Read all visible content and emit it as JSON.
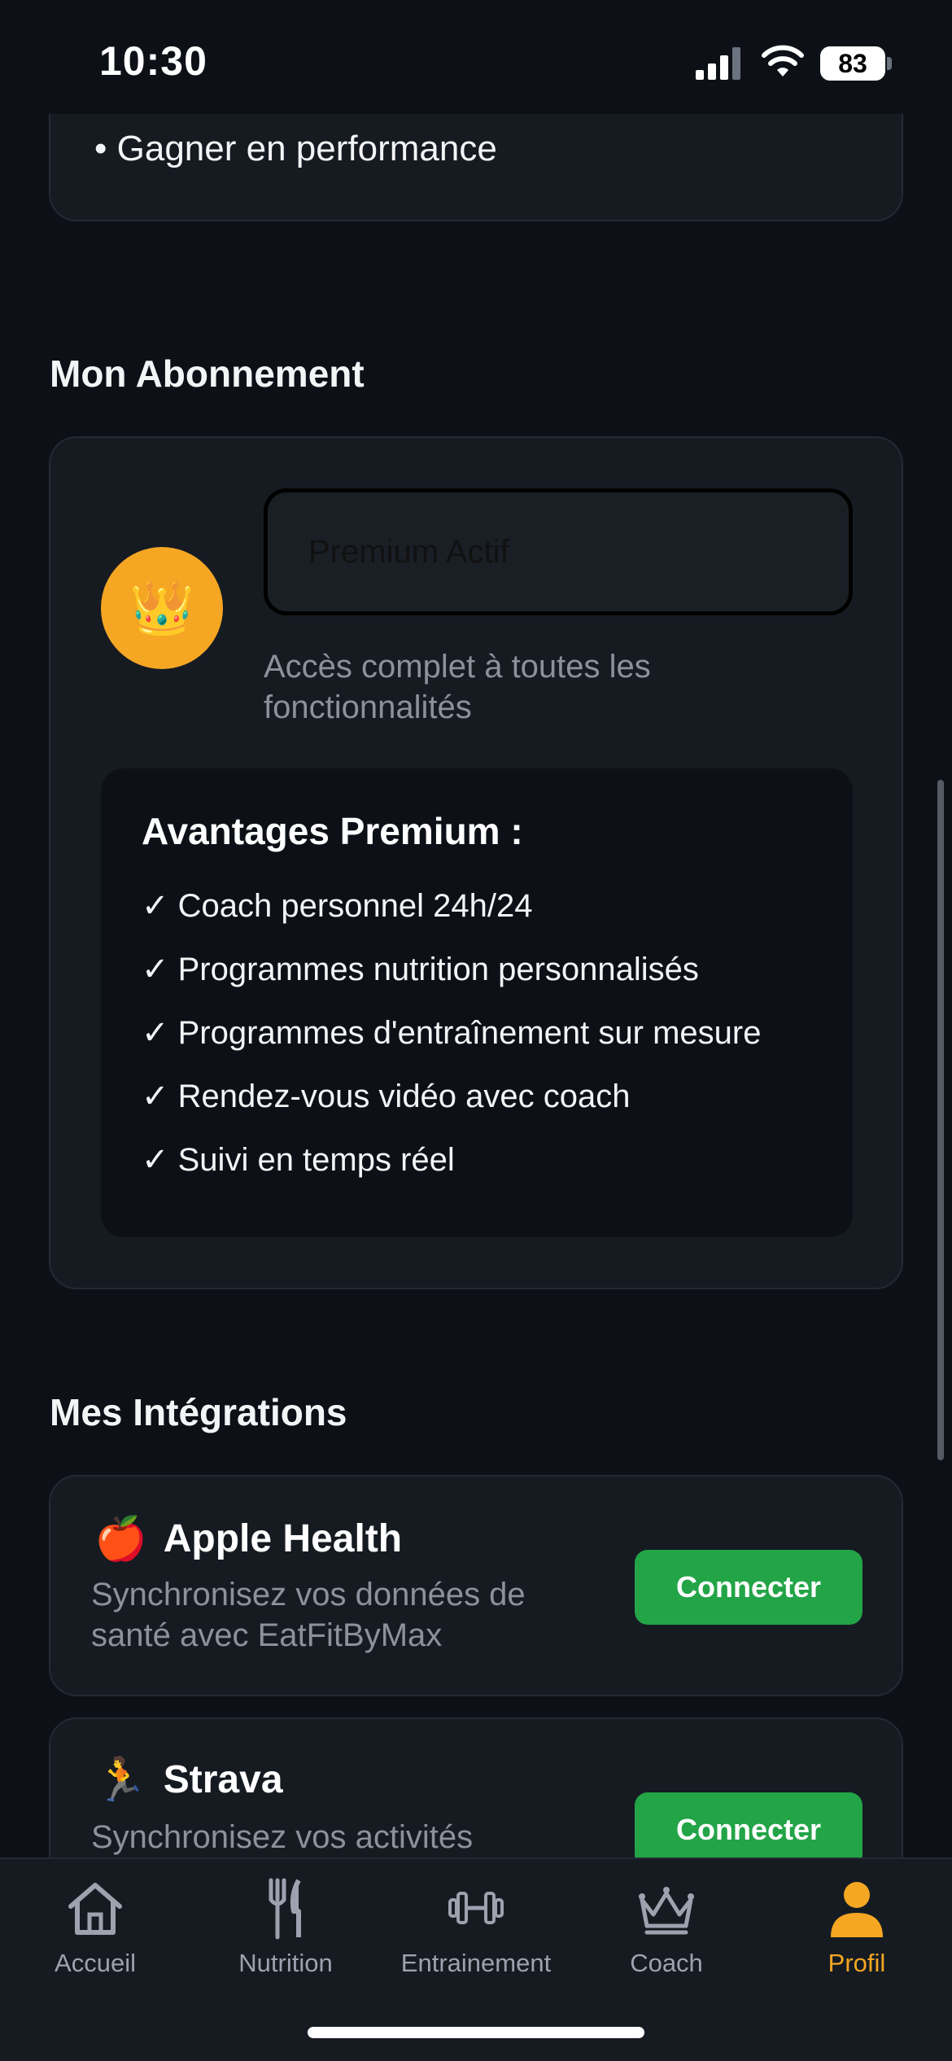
{
  "status_bar": {
    "time": "10:30",
    "battery": "83"
  },
  "goals": {
    "last_item": "• Gagner en performance"
  },
  "subscription": {
    "section_title": "Mon Abonnement",
    "plan_value": "Premium Actif",
    "crown_icon": "👑",
    "description": "Accès complet à toutes les fonctionnalités",
    "benefits_title": "Avantages Premium :",
    "benefits": [
      "✓ Coach personnel 24h/24",
      "✓ Programmes nutrition personnalisés",
      "✓ Programmes d'entraînement sur mesure",
      "✓ Rendez-vous vidéo avec coach",
      "✓ Suivi en temps réel"
    ]
  },
  "integrations": {
    "section_title": "Mes Intégrations",
    "items": [
      {
        "icon": "🍎",
        "name": "Apple Health",
        "description": "Synchronisez vos données de santé avec EatFitByMax",
        "button": "Connecter"
      },
      {
        "icon": "🏃",
        "name": "Strava",
        "description": "Synchronisez vos activités",
        "button": "Connecter"
      }
    ]
  },
  "tab_bar": {
    "tabs": [
      {
        "label": "Accueil",
        "icon": "home-icon"
      },
      {
        "label": "Nutrition",
        "icon": "fork-knife-icon"
      },
      {
        "label": "Entrainement",
        "icon": "dumbbell-icon"
      },
      {
        "label": "Coach",
        "icon": "crown-icon"
      },
      {
        "label": "Profil",
        "icon": "person-icon"
      }
    ],
    "active": "Profil"
  },
  "colors": {
    "background": "#0d1117",
    "card": "#161b22",
    "accent": "#f5a623",
    "connect": "#22a447",
    "muted_text": "#8b929c"
  }
}
